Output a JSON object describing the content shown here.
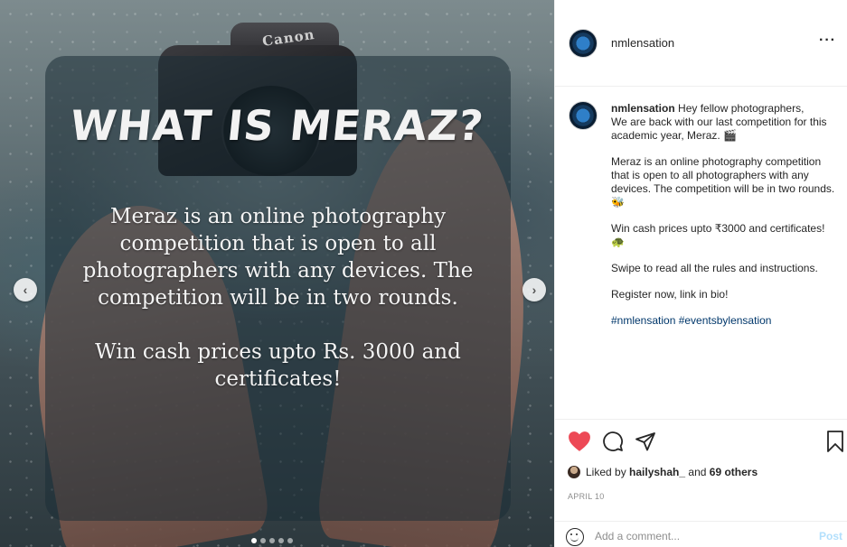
{
  "media": {
    "camera_brand": "Canon",
    "title": "WHAT IS MERAZ?",
    "body_paragraphs": [
      "Meraz is an online photography competition that is open to all photographers with any devices. The competition will be in two rounds.",
      "Win cash prices upto Rs. 3000 and certificates!"
    ],
    "prev_arrow": "‹",
    "next_arrow": "›",
    "slide_count": 5,
    "active_slide": 1
  },
  "header": {
    "username": "nmlensation",
    "more": "···"
  },
  "caption": {
    "username": "nmlensation",
    "intro": " Hey fellow photographers,",
    "line2": "We are back with our last competition for this academic year, Meraz. 🎬",
    "para2": "Meraz is an online photography competition that is open to all photographers with any devices. The competition will be in two rounds. 🐝",
    "para3": "Win cash prices upto ₹3000 and certificates! 🐢",
    "para4": "Swipe to read all the rules and instructions.",
    "para5": "Register now, link in bio!",
    "hashtags": "#nmlensation #eventsbylensation"
  },
  "likes": {
    "prefix": "Liked by ",
    "user": "hailyshah_",
    "middle": " and ",
    "others": "69 others"
  },
  "date": "APRIL 10",
  "comment": {
    "placeholder": "Add a comment...",
    "post_label": "Post"
  },
  "colors": {
    "heart": "#ed4956",
    "link": "#00376b",
    "post_disabled": "#b2dffc"
  }
}
